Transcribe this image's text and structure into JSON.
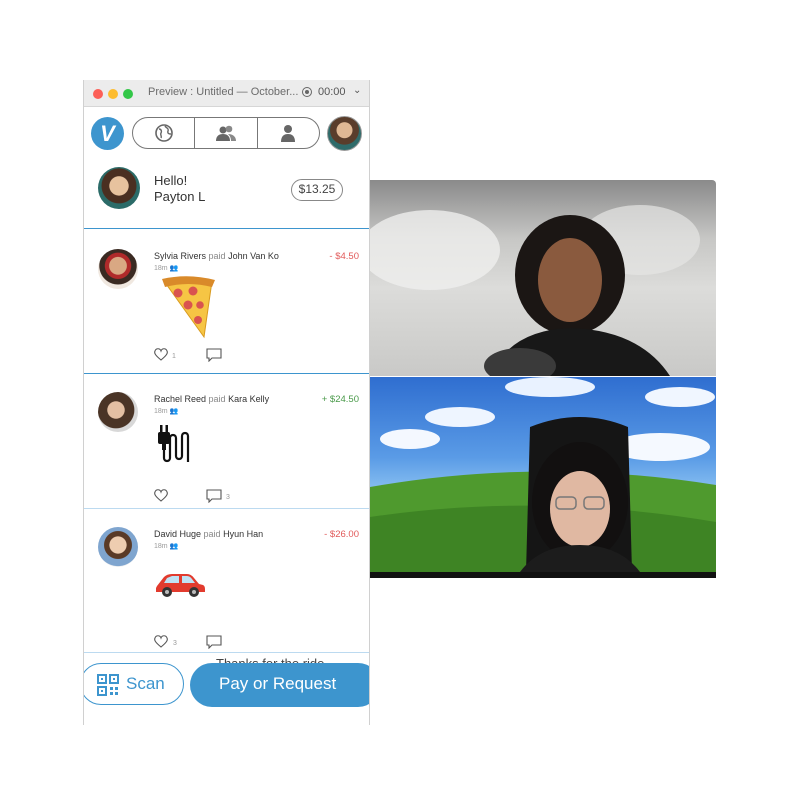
{
  "window": {
    "title": "Preview : Untitled — October...",
    "timer": "00:00"
  },
  "nav": {
    "logo": "V",
    "tabs": [
      {
        "icon": "globe-icon"
      },
      {
        "icon": "friends-icon"
      },
      {
        "icon": "person-icon"
      }
    ]
  },
  "greeting": {
    "hello": "Hello!",
    "name": "Payton L",
    "balance": "$13.25"
  },
  "feed": [
    {
      "payer": "Sylvia Rivers",
      "verb": "paid",
      "payee": "John Van Ko",
      "time": "18m",
      "amount": "- $4.50",
      "sign": "negative",
      "emoji": "pizza-icon",
      "likes": "1",
      "comments": ""
    },
    {
      "payer": "Rachel Reed",
      "verb": "paid",
      "payee": "Kara Kelly",
      "time": "18m",
      "amount": "+ $24.50",
      "sign": "positive",
      "emoji": "plug-icon",
      "likes": "",
      "comments": "3"
    },
    {
      "payer": "David Huge",
      "verb": "paid",
      "payee": "Hyun Han",
      "time": "18m",
      "amount": "- $26.00",
      "sign": "negative",
      "emoji": "car-icon",
      "note": "Thanks for the ride",
      "likes": "3",
      "comments": ""
    }
  ],
  "actions": {
    "scan": "Scan",
    "pay_request": "Pay or Request"
  },
  "colors": {
    "brand": "#3d95ce",
    "negative": "#e15a5a",
    "positive": "#4a9a4a"
  }
}
